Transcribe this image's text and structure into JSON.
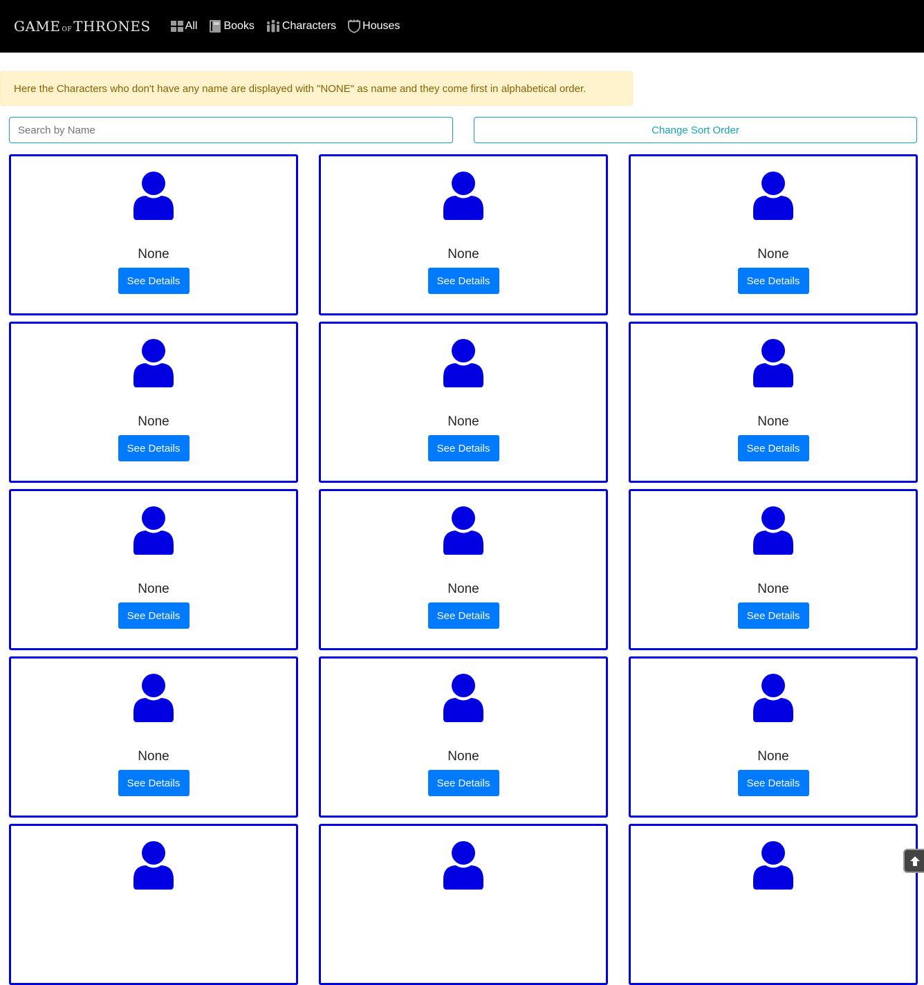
{
  "navbar": {
    "brand": {
      "word1": "GAME",
      "word2": "OF",
      "word3": "THRONES"
    },
    "links": [
      {
        "label": "All",
        "icon": "grid-icon"
      },
      {
        "label": "Books",
        "icon": "book-icon"
      },
      {
        "label": "Characters",
        "icon": "people-icon"
      },
      {
        "label": "Houses",
        "icon": "shield-icon"
      }
    ]
  },
  "alert": {
    "text": "Here the Characters who don't have any name are displayed with \"NONE\" as name and they come first in alphabetical order."
  },
  "search": {
    "placeholder": "Search by Name",
    "value": ""
  },
  "sort_button": {
    "label": "Change Sort Order"
  },
  "characters": [
    {
      "name": "None",
      "button": "See Details"
    },
    {
      "name": "None",
      "button": "See Details"
    },
    {
      "name": "None",
      "button": "See Details"
    },
    {
      "name": "None",
      "button": "See Details"
    },
    {
      "name": "None",
      "button": "See Details"
    },
    {
      "name": "None",
      "button": "See Details"
    },
    {
      "name": "None",
      "button": "See Details"
    },
    {
      "name": "None",
      "button": "See Details"
    },
    {
      "name": "None",
      "button": "See Details"
    },
    {
      "name": "None",
      "button": "See Details"
    },
    {
      "name": "None",
      "button": "See Details"
    },
    {
      "name": "None",
      "button": "See Details"
    },
    {
      "name": "",
      "button": ""
    },
    {
      "name": "",
      "button": ""
    },
    {
      "name": "",
      "button": ""
    }
  ],
  "colors": {
    "navbar_bg": "#000000",
    "card_border": "#0000e0",
    "avatar": "#0000e0",
    "primary_button": "#007bff",
    "info_outline": "#17a2b8",
    "alert_bg": "#fff3cd",
    "alert_text": "#856404"
  },
  "icons": {
    "avatar": "user-icon",
    "scroll_top": "arrow-up-icon"
  }
}
